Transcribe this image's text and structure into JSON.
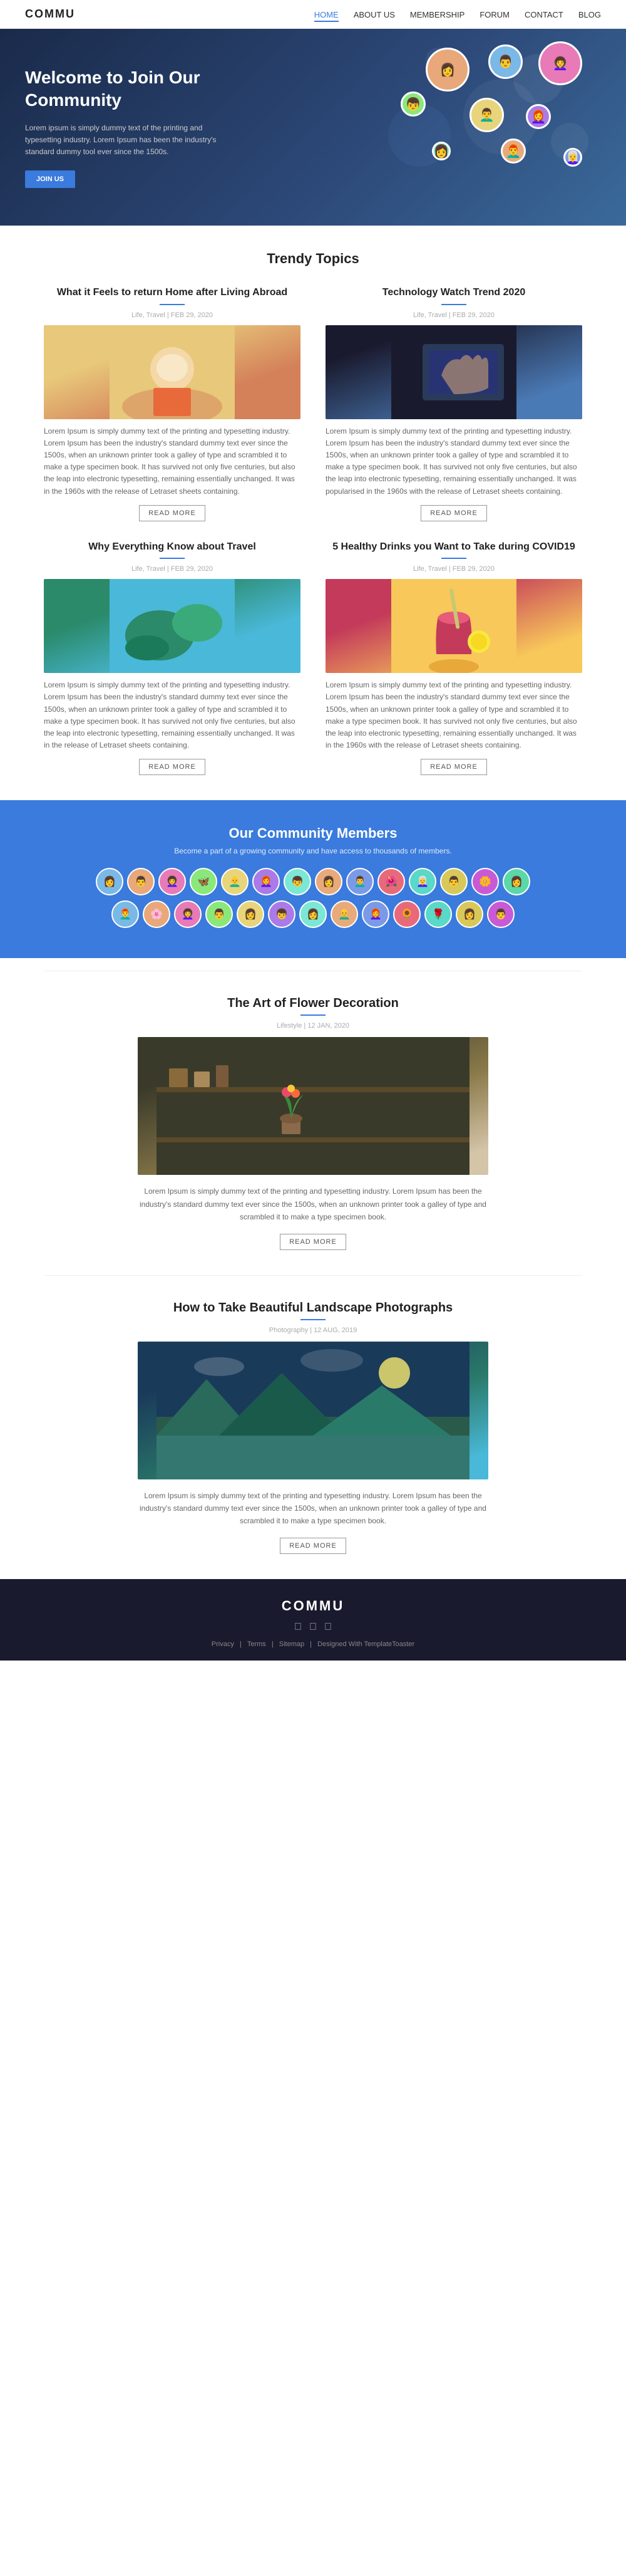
{
  "site": {
    "logo": "COMMU"
  },
  "nav": {
    "links": [
      {
        "label": "HOME",
        "active": true
      },
      {
        "label": "ABOUT US",
        "active": false
      },
      {
        "label": "MEMBERSHIP",
        "active": false
      },
      {
        "label": "FORUM",
        "active": false
      },
      {
        "label": "CONTACT",
        "active": false
      },
      {
        "label": "BLOG",
        "active": false
      }
    ]
  },
  "hero": {
    "heading": "Welcome to Join Our Community",
    "description": "Lorem ipsum is simply dummy text of the printing and typesetting industry. Lorem Ipsum has been the industry's standard dummy tool ever since the 1500s.",
    "cta_button": "JOIN US"
  },
  "trendy": {
    "section_title": "Trendy Topics",
    "cards": [
      {
        "id": "card1",
        "title": "What it Feels to return Home after Living Abroad",
        "category": "Life, Travel",
        "date": "FEB 29, 2020",
        "text": "Lorem Ipsum is simply dummy text of the printing and typesetting industry. Lorem Ipsum has been the industry's standard dummy text ever since the 1500s, when an unknown printer took a galley of type and scrambled it to make a type specimen book. It has survived not only five centuries, but also the leap into electronic typesetting, remaining essentially unchanged. It was in the 1960s with the release of Letraset sheets containing.",
        "img_class": "img-travel-girl",
        "read_more": "READ MORE"
      },
      {
        "id": "card2",
        "title": "Technology Watch Trend 2020",
        "category": "Life, Travel",
        "date": "FEB 29, 2020",
        "text": "Lorem Ipsum is simply dummy text of the printing and typesetting industry. Lorem Ipsum has been the industry's standard dummy text ever since the 1500s, when an unknown printer took a galley of type and scrambled it to make a type specimen book. It has survived not only five centuries, but also the leap into electronic typesetting, remaining essentially unchanged. It was popularised in the 1960s with the release of Letraset sheets containing.",
        "img_class": "img-tech",
        "read_more": "READ MORE"
      },
      {
        "id": "card3",
        "title": "Why Everything Know about Travel",
        "category": "Life, Travel",
        "date": "FEB 29, 2020",
        "text": "Lorem Ipsum is simply dummy text of the printing and typesetting industry. Lorem Ipsum has been the industry's standard dummy text ever since the 1500s, when an unknown printer took a galley of type and scrambled it to make a type specimen book. It has survived not only five centuries, but also the leap into electronic typesetting, remaining essentially unchanged. It was in the release of Letraset sheets containing.",
        "img_class": "img-travel-aerial",
        "read_more": "READ MORE"
      },
      {
        "id": "card4",
        "title": "5 Healthy Drinks you Want to Take during COVID19",
        "category": "Life, Travel",
        "date": "FEB 29, 2020",
        "text": "Lorem Ipsum is simply dummy text of the printing and typesetting industry. Lorem Ipsum has been the industry's standard dummy text ever since the 1500s, when an unknown printer took a galley of type and scrambled it to make a type specimen book. It has survived not only five centuries, but also the leap into electronic typesetting, remaining essentially unchanged. It was in the 1960s with the release of Letraset sheets containing.",
        "img_class": "img-drinks",
        "read_more": "READ MORE"
      }
    ]
  },
  "community": {
    "title": "Our Community Members",
    "subtitle": "Become a part of a growing community and have access to thousands of members.",
    "member_emojis": [
      "👩",
      "👨",
      "👩‍🦱",
      "🦋",
      "👨‍🦲",
      "👩‍🦰",
      "👦",
      "👩",
      "👨‍🦱",
      "🌺",
      "👩‍🦳",
      "👨",
      "🌼",
      "👩",
      "👨‍🦰",
      "🌸",
      "👩‍🦱",
      "👨",
      "👩",
      "👦",
      "👩",
      "👨‍🦲",
      "👩‍🦰",
      "🌻",
      "🌹",
      "👩",
      "👨"
    ]
  },
  "featured": [
    {
      "id": "feat1",
      "category": "Lifestyle",
      "date": "12 JAN, 2020",
      "title": "The Art of Flower Decoration",
      "text": "Lorem Ipsum is simply dummy text of the printing and typesetting industry. Lorem Ipsum has been the industry's standard dummy text ever since the 1500s, when an unknown printer took a galley of type and scrambled it to make a type specimen book.",
      "img_class": "img-flower",
      "read_more": "READ MORE"
    },
    {
      "id": "feat2",
      "category": "Photography",
      "date": "12 AUG, 2019",
      "title": "How to Take Beautiful Landscape Photographs",
      "text": "Lorem Ipsum is simply dummy text of the printing and typesetting industry. Lorem Ipsum has been the industry's standard dummy text ever since the 1500s, when an unknown printer took a galley of type and scrambled it to make a type specimen book.",
      "img_class": "img-landscape",
      "read_more": "READ MORE"
    }
  ],
  "footer": {
    "logo": "COMMU",
    "links": [
      {
        "label": "Privacy"
      },
      {
        "label": "Terms"
      },
      {
        "label": "Sitemap"
      },
      {
        "label": "Designed With TemplateToaster"
      }
    ]
  }
}
